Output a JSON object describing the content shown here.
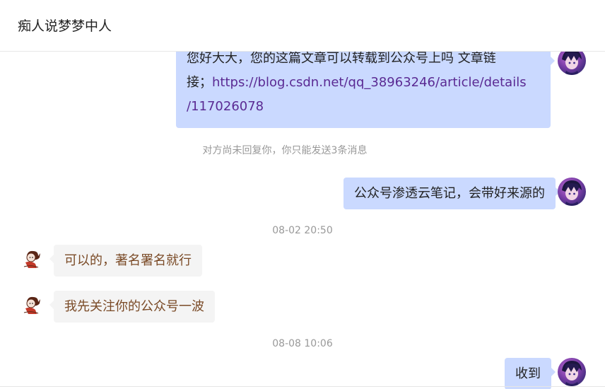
{
  "header": {
    "title": "痴人说梦梦中人"
  },
  "messages": {
    "m1": {
      "line1": "您好大大，您的这篇文章可以转载到公众号上吗 文章链",
      "line2_prefix": "接；",
      "link_part1": "https://blog.csdn.net/qq_38963246/article/details",
      "link_part2": "/117026078"
    },
    "notice": "对方尚未回复你，你只能发送3条消息",
    "m2": "公众号渗透云笔记，会带好来源的",
    "time1": "08-02 20:50",
    "m3": "可以的，著名署名就行",
    "m4": "我先关注你的公众号一波",
    "time2": "08-08 10:06",
    "m5": "收到"
  },
  "colors": {
    "outgoing_bubble": "#cad9ff",
    "incoming_bubble": "#f4f4f4",
    "incoming_text": "#7a4a26",
    "link": "#5a2a93"
  },
  "icons": {
    "self_avatar": "anime-boy-avatar",
    "peer_avatar": "girl-doodle-avatar"
  }
}
